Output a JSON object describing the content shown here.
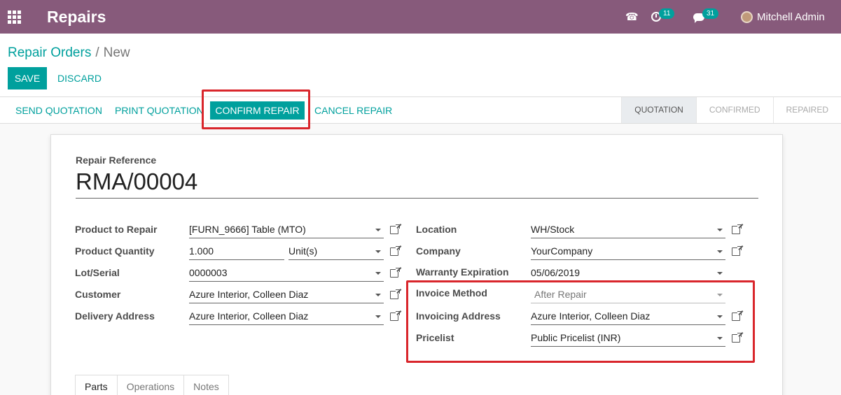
{
  "navbar": {
    "app_title": "Repairs",
    "activity_count": "11",
    "messages_count": "31",
    "user_name": "Mitchell Admin"
  },
  "breadcrumb": {
    "parent": "Repair Orders",
    "separator": "/",
    "current": "New"
  },
  "control": {
    "save_label": "SAVE",
    "discard_label": "DISCARD"
  },
  "statusbar": {
    "send_quotation": "SEND QUOTATION",
    "print_quotation": "PRINT QUOTATION",
    "confirm_repair": "CONFIRM REPAIR",
    "cancel_repair": "CANCEL REPAIR",
    "stages": [
      "QUOTATION",
      "CONFIRMED",
      "REPAIRED"
    ],
    "active_stage": "QUOTATION"
  },
  "form": {
    "ref_label": "Repair Reference",
    "ref_value": "RMA/00004",
    "left": {
      "product_label": "Product to Repair",
      "product_value": "[FURN_9666] Table (MTO)",
      "qty_label": "Product Quantity",
      "qty_value": "1.000",
      "uom_value": "Unit(s)",
      "lot_label": "Lot/Serial",
      "lot_value": "0000003",
      "customer_label": "Customer",
      "customer_value": "Azure Interior, Colleen Diaz",
      "delivery_label": "Delivery Address",
      "delivery_value": "Azure Interior, Colleen Diaz"
    },
    "right": {
      "location_label": "Location",
      "location_value": "WH/Stock",
      "company_label": "Company",
      "company_value": "YourCompany",
      "warranty_label": "Warranty Expiration",
      "warranty_value": "05/06/2019",
      "invoice_method_label": "Invoice Method",
      "invoice_method_value": "After Repair",
      "invoicing_address_label": "Invoicing Address",
      "invoicing_address_value": "Azure Interior, Colleen Diaz",
      "pricelist_label": "Pricelist",
      "pricelist_value": "Public Pricelist (INR)"
    },
    "tabs": [
      "Parts",
      "Operations",
      "Notes"
    ]
  },
  "colors": {
    "brand": "#875a7b",
    "accent": "#00a09d",
    "highlight": "#d9262c"
  }
}
